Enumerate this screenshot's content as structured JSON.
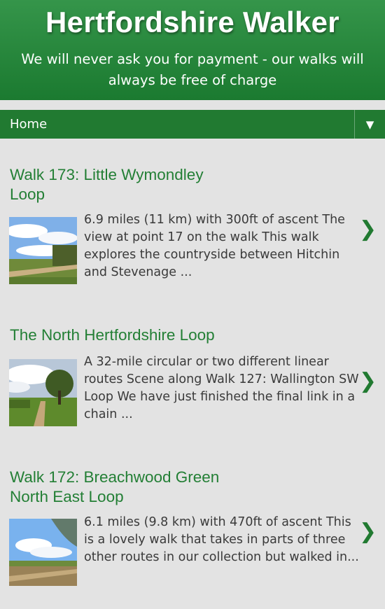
{
  "header": {
    "title": "Hertfordshire Walker",
    "tagline": "We will never ask you for payment - our walks will always be free of charge"
  },
  "nav": {
    "home_label": "Home",
    "toggle_symbol": "▼"
  },
  "posts": [
    {
      "title": "Walk 173: Little Wymondley Loop",
      "excerpt": "6.9 miles (11 km) with 300ft of ascent The view at point 17 on the walk This walk explores the countryside between Hitchin and Stevenage ...",
      "chevron": "❯"
    },
    {
      "title": "The North Hertfordshire Loop",
      "excerpt": "A 32-mile circular or two different linear routes Scene along Walk 127: Wallington SW Loop We have just finished the final link in a chain ...",
      "chevron": "❯"
    },
    {
      "title": "Walk 172: Breachwood Green North East Loop",
      "excerpt": "6.1 miles (9.8 km) with 470ft of ascent   This is a lovely walk that takes in parts of three other routes in our collection but walked in...",
      "chevron": "❯"
    }
  ]
}
